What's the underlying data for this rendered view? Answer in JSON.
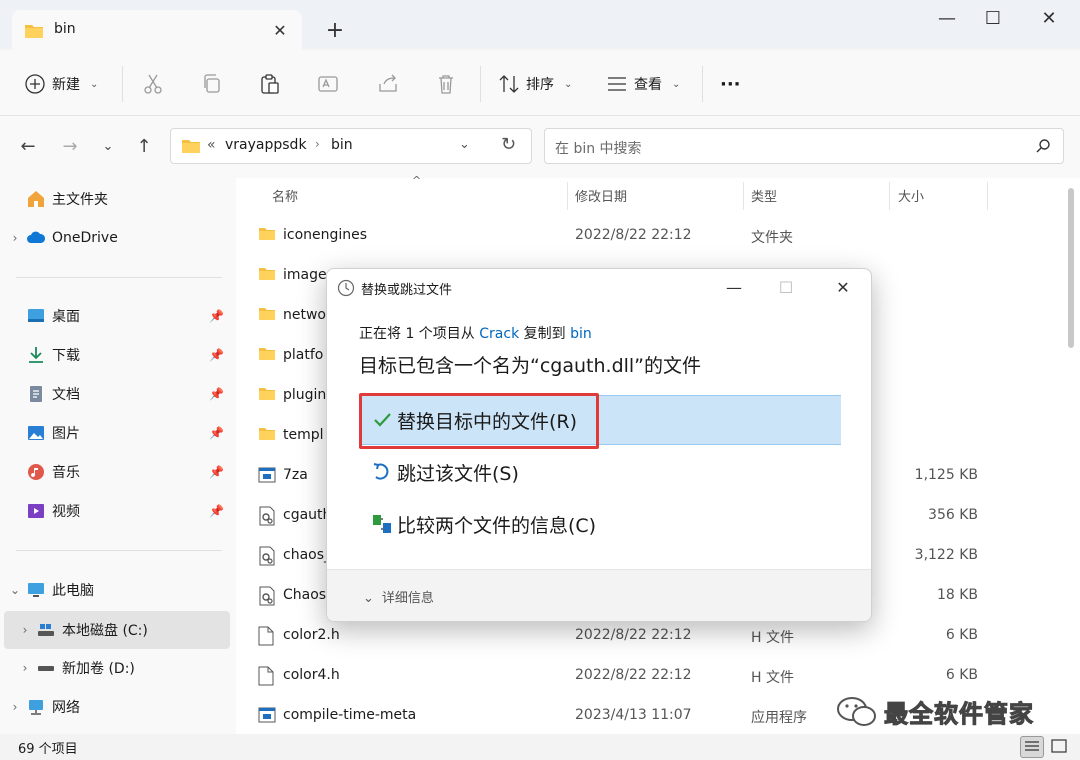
{
  "window": {
    "tab_title": "bin",
    "new_tab": "+",
    "close_tab": "✕"
  },
  "toolbar": {
    "new_label": "新建",
    "sort_label": "排序",
    "view_label": "查看",
    "more": "···"
  },
  "address": {
    "overflow": "«",
    "crumbs": [
      "vrayappsdk",
      "bin"
    ],
    "search_placeholder": "在 bin 中搜索"
  },
  "sidebar": {
    "items": [
      {
        "label": "主文件夹",
        "icon": "home-icon"
      },
      {
        "label": "OneDrive",
        "icon": "cloud-icon"
      },
      {
        "label": "桌面",
        "icon": "desktop-icon"
      },
      {
        "label": "下载",
        "icon": "download-icon"
      },
      {
        "label": "文档",
        "icon": "document-icon"
      },
      {
        "label": "图片",
        "icon": "picture-icon"
      },
      {
        "label": "音乐",
        "icon": "music-icon"
      },
      {
        "label": "视频",
        "icon": "video-icon"
      },
      {
        "label": "此电脑",
        "icon": "computer-icon"
      },
      {
        "label": "本地磁盘 (C:)",
        "icon": "drive-icon"
      },
      {
        "label": "新加卷 (D:)",
        "icon": "drive-icon"
      },
      {
        "label": "网络",
        "icon": "network-icon"
      }
    ]
  },
  "columns": {
    "name": "名称",
    "date": "修改日期",
    "type": "类型",
    "size": "大小"
  },
  "files": [
    {
      "name": "iconengines",
      "date": "2022/8/22 22:12",
      "type": "文件夹",
      "size": "",
      "icon": "folder-icon"
    },
    {
      "name": "image",
      "date": "",
      "type": "",
      "size": "",
      "icon": "folder-icon"
    },
    {
      "name": "netwo",
      "date": "",
      "type": "",
      "size": "",
      "icon": "folder-icon"
    },
    {
      "name": "platfo",
      "date": "",
      "type": "",
      "size": "",
      "icon": "folder-icon"
    },
    {
      "name": "plugin",
      "date": "",
      "type": "",
      "size": "",
      "icon": "folder-icon"
    },
    {
      "name": "templ",
      "date": "",
      "type": "",
      "size": "",
      "icon": "folder-icon"
    },
    {
      "name": "7za",
      "date": "",
      "type": "",
      "size": "1,125 KB",
      "icon": "app-icon"
    },
    {
      "name": "cgauth",
      "date": "",
      "type": "",
      "size": "356 KB",
      "icon": "dll-icon"
    },
    {
      "name": "chaos_",
      "date": "",
      "type": "",
      "size": "3,122 KB",
      "icon": "dll-icon"
    },
    {
      "name": "Chaos",
      "date": "",
      "type": "",
      "size": "18 KB",
      "icon": "dll-icon"
    },
    {
      "name": "color2.h",
      "date": "2022/8/22 22:12",
      "type": "H 文件",
      "size": "6 KB",
      "icon": "file-icon"
    },
    {
      "name": "color4.h",
      "date": "2022/8/22 22:12",
      "type": "H 文件",
      "size": "6 KB",
      "icon": "file-icon"
    },
    {
      "name": "compile-time-meta",
      "date": "2023/4/13 11:07",
      "type": "应用程序",
      "size": "",
      "icon": "app-icon"
    }
  ],
  "status": {
    "count": "69 个项目"
  },
  "dialog": {
    "title": "替换或跳过文件",
    "line1_prefix": "正在将 1 个项目从 ",
    "source": "Crack",
    "line1_mid": " 复制到 ",
    "target": "bin",
    "heading": "目标已包含一个名为“cgauth.dll”的文件",
    "replace": "替换目标中的文件(R)",
    "skip": "跳过该文件(S)",
    "compare": "比较两个文件的信息(C)",
    "details": "详细信息"
  },
  "watermark": {
    "text": "最全软件管家"
  }
}
